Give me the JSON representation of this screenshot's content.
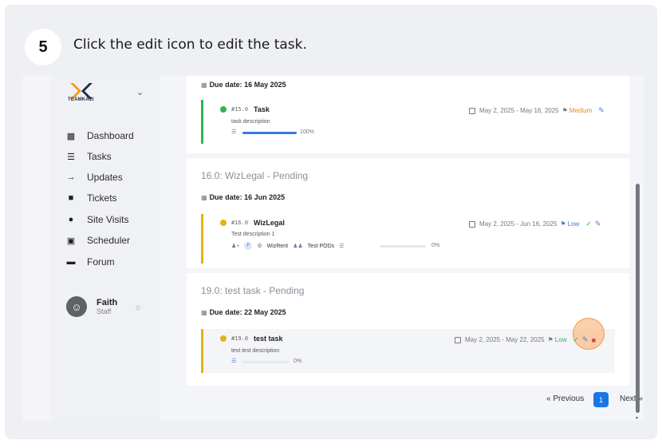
{
  "tutorial": {
    "step_number": "5",
    "instruction": "Click the edit icon to edit the task."
  },
  "sidebar": {
    "logo_text": "TEAMKAZI",
    "items": [
      {
        "label": "Dashboard",
        "icon": "dashboard-icon"
      },
      {
        "label": "Tasks",
        "icon": "tasks-icon"
      },
      {
        "label": "Updates",
        "icon": "updates-icon"
      },
      {
        "label": "Tickets",
        "icon": "ticket-icon"
      },
      {
        "label": "Site Visits",
        "icon": "location-pin-icon"
      },
      {
        "label": "Scheduler",
        "icon": "calendar-icon"
      },
      {
        "label": "Forum",
        "icon": "forum-icon"
      }
    ],
    "user": {
      "name": "Faith",
      "role": "Staff"
    }
  },
  "tasks": {
    "group1": {
      "due": "Due date: 16 May 2025",
      "id": "#15.0",
      "name": "Task",
      "description": "task description",
      "progress_label": "100%",
      "progress": 1.0,
      "date_range": "May 2, 2025 - May 16, 2025",
      "priority": "Medium"
    },
    "group2": {
      "title": "16.0: WizLegal - Pending",
      "due": "Due date: 16 Jun 2025",
      "id": "#16.0",
      "name": "WizLegal",
      "description": "Test description 1",
      "assignee_initial": "F",
      "product": "WizRent",
      "team": "Test PODs",
      "progress_label": "0%",
      "progress": 0,
      "date_range": "May 2, 2025 - Jun 16, 2025",
      "priority": "Low"
    },
    "group3": {
      "title": "19.0: test task - Pending",
      "due": "Due date: 22 May 2025",
      "id": "#19.0",
      "name": "test task",
      "description": "test test description",
      "progress_label": "0%",
      "progress": 0,
      "date_range": "May 2, 2025 - May 22, 2025",
      "priority": "Low"
    }
  },
  "pagination": {
    "previous": "« Previous",
    "current": "1",
    "next": "Next »"
  },
  "colors": {
    "green": "#2fb553",
    "amber": "#e2b312",
    "blue": "#1976e8",
    "medium": "#e28a1d",
    "low": "#2fb553"
  }
}
